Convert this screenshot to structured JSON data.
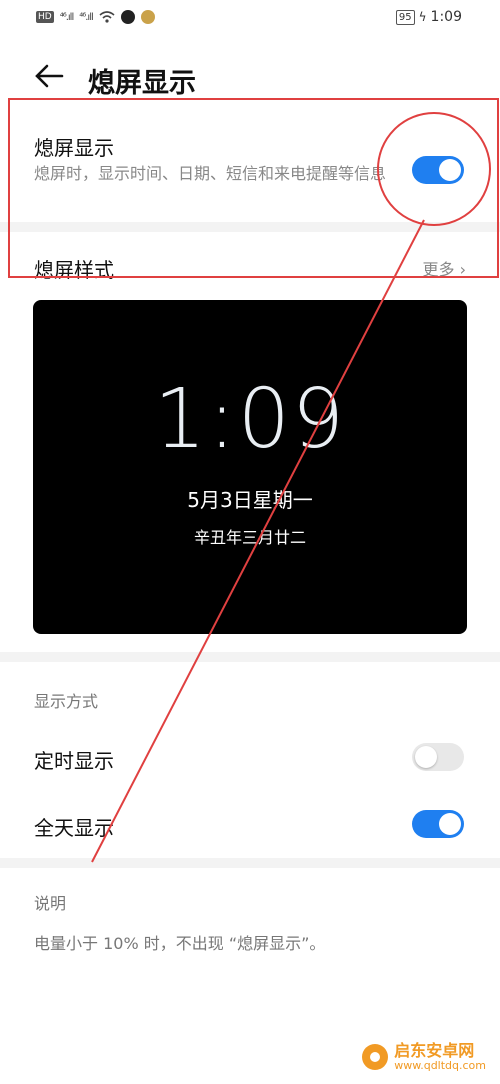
{
  "status_bar": {
    "left_hd": "HD",
    "left_signal1": "⁴⁶.ıll",
    "left_signal2": "⁴⁶.ıll",
    "battery": "95",
    "time": "1:09"
  },
  "header": {
    "title": "熄屏显示"
  },
  "aod_setting": {
    "title": "熄屏显示",
    "description": "熄屏时，显示时间、日期、短信和来电提醒等信息",
    "enabled": true
  },
  "style_row": {
    "title": "熄屏样式",
    "more": "更多 ›"
  },
  "preview": {
    "time": "1:09",
    "date": "5月3日星期一",
    "lunar": "辛丑年三月廿二"
  },
  "display_mode": {
    "section_label": "显示方式",
    "timed": {
      "label": "定时显示",
      "enabled": false
    },
    "all_day": {
      "label": "全天显示",
      "enabled": true
    }
  },
  "note": {
    "section_label": "说明",
    "text": "电量小于 10% 时，不出现 “熄屏显示”。"
  },
  "watermark": {
    "brand": "启东安卓网",
    "url": "www.qdltdq.com"
  },
  "colors": {
    "accent": "#1f7ff0",
    "annotation": "#e04040"
  }
}
